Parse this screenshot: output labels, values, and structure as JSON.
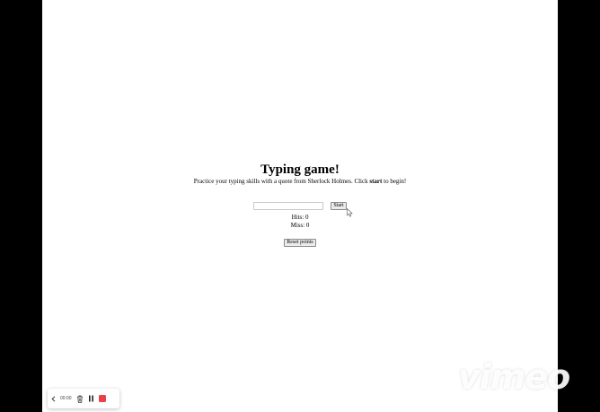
{
  "game": {
    "title": "Typing game!",
    "intro_before": "Practice your typing skills with a quote from Sherlock Holmes. Click ",
    "intro_bold": "start",
    "intro_after": " to begin!",
    "input_value": "",
    "start_label": "Start",
    "hits_label": "Hits: ",
    "hits": "0",
    "miss_label": "Miss: ",
    "miss": "0",
    "reset_label": "Reset points"
  },
  "recorder": {
    "time": "00:00",
    "icons": [
      "chevron-left-icon",
      "trash-icon",
      "pause-icon",
      "stop-icon"
    ],
    "stop_color": "#e8414a"
  },
  "watermark": {
    "text": "vimeo"
  }
}
